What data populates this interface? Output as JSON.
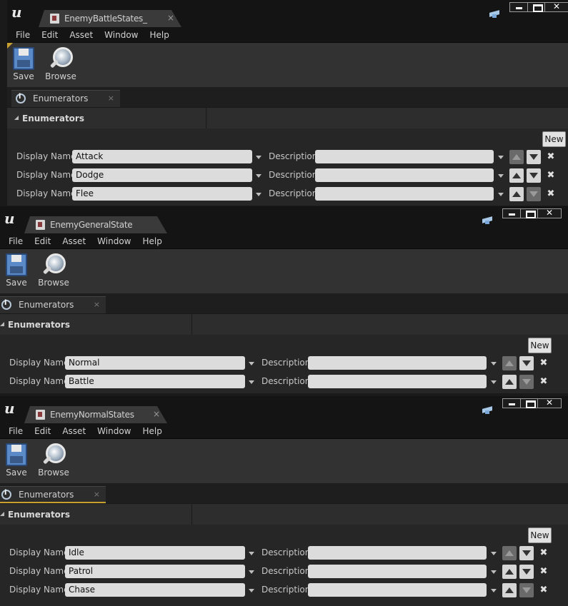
{
  "menu": [
    "File",
    "Edit",
    "Asset",
    "Window",
    "Help"
  ],
  "toolbar": {
    "save_label": "Save",
    "browse_label": "Browse"
  },
  "panel": {
    "tab_label": "Enumerators",
    "section_title": "Enumerators",
    "new_label": "New",
    "display_name_label": "Display Name",
    "description_label": "Description",
    "close_glyph": "×"
  },
  "windows": [
    {
      "tab_title": "EnemyBattleStates_",
      "enumerators": [
        {
          "display_name": "Attack",
          "description": "",
          "up_enabled": false,
          "down_enabled": true
        },
        {
          "display_name": "Dodge",
          "description": "",
          "up_enabled": true,
          "down_enabled": true
        },
        {
          "display_name": "Flee",
          "description": "",
          "up_enabled": true,
          "down_enabled": false
        }
      ]
    },
    {
      "tab_title": "EnemyGeneralState",
      "enumerators": [
        {
          "display_name": "Normal",
          "description": "",
          "up_enabled": false,
          "down_enabled": true
        },
        {
          "display_name": "Battle",
          "description": "",
          "up_enabled": true,
          "down_enabled": false
        }
      ]
    },
    {
      "tab_title": "EnemyNormalStates",
      "enumerators": [
        {
          "display_name": "Idle",
          "description": "",
          "up_enabled": false,
          "down_enabled": true
        },
        {
          "display_name": "Patrol",
          "description": "",
          "up_enabled": true,
          "down_enabled": true
        },
        {
          "display_name": "Chase",
          "description": "",
          "up_enabled": true,
          "down_enabled": false
        }
      ]
    }
  ]
}
